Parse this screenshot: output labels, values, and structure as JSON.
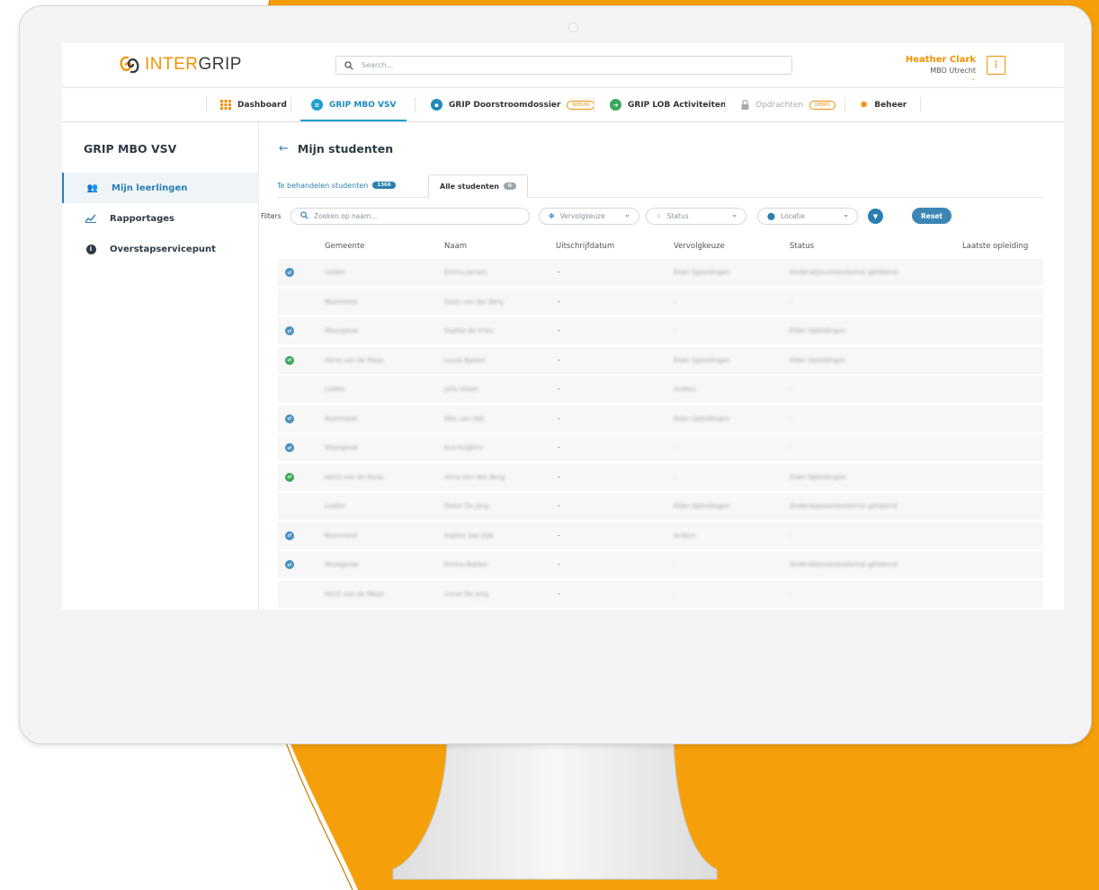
{
  "app": {
    "logo_text_accent": "INTER",
    "logo_text": "GRIP",
    "search_placeholder": "Search...",
    "user_name": "Heather Clark",
    "user_org": "MBO Utrecht",
    "menu_icon": "kebab-icon"
  },
  "tabs": [
    {
      "label": "Dashboard",
      "icon": "grid-icon",
      "state": "normal"
    },
    {
      "label": "GRIP MBO VSV",
      "icon": "filter-icon",
      "state": "active"
    },
    {
      "label": "GRIP Doorstroomdossier",
      "icon": "lock-icon",
      "state": "normal",
      "badge": "NIEUW"
    },
    {
      "label": "GRIP LOB Activiteiten",
      "icon": "run-icon",
      "state": "normal"
    },
    {
      "label": "Opdrachten",
      "icon": "lock-icon",
      "state": "disabled",
      "badge": "DEMO"
    },
    {
      "label": "Beheer",
      "icon": "gear-icon",
      "state": "normal"
    }
  ],
  "sidebar": {
    "title": "GRIP MBO VSV",
    "items": [
      {
        "label": "Mijn leerlingen",
        "icon": "users-icon",
        "active": true
      },
      {
        "label": "Rapportages",
        "icon": "chart-icon",
        "active": false
      },
      {
        "label": "Overstapservicepunt",
        "icon": "info-icon",
        "active": false
      }
    ]
  },
  "main": {
    "title": "Mijn studenten",
    "subtabs": [
      {
        "label": "Te behandelen studenten",
        "count": "1366",
        "selected": false
      },
      {
        "label": "Alle studenten",
        "count": "0",
        "selected": true
      }
    ],
    "filters": {
      "label": "Filters",
      "search_placeholder": "Zoeken op naam...",
      "vervolgkeuze": "Vervolgkeuze",
      "status": "Status",
      "locatie": "Locatie",
      "reset": "Reset"
    },
    "columns": [
      "Gemeente",
      "Naam",
      "Uitschrijfdatum",
      "Vervolgkeuze",
      "Status",
      "Laatste opleiding"
    ],
    "rows": [
      {
        "icon": "blue",
        "gemeente": "Leiden",
        "naam": "Emma Jansen",
        "datum": "-",
        "vervolg": "Elder Opleidingen",
        "status": "Onderwijsovereenkomst getekend"
      },
      {
        "icon": "",
        "gemeente": "Roermond",
        "naam": "Daan van der Berg",
        "datum": "-",
        "vervolg": "-",
        "status": "-"
      },
      {
        "icon": "blue",
        "gemeente": "Maasgouw",
        "naam": "Sophie de Vries",
        "datum": "-",
        "vervolg": "-",
        "status": "Elder Opleidingen"
      },
      {
        "icon": "green",
        "gemeente": "Horst aan de Maas",
        "naam": "Lucas Bakker",
        "datum": "-",
        "vervolg": "Elder Opleidingen",
        "status": "Elder Opleidingen"
      },
      {
        "icon": "",
        "gemeente": "Leiden",
        "naam": "Julia Visser",
        "datum": "-",
        "vervolg": "Anders",
        "status": "-"
      },
      {
        "icon": "blue",
        "gemeente": "Roermond",
        "naam": "Milo van Dijk",
        "datum": "-",
        "vervolg": "Elder Opleidingen",
        "status": "-"
      },
      {
        "icon": "blue",
        "gemeente": "Maasgouw",
        "naam": "Eva Kuijpers",
        "datum": "-",
        "vervolg": "-",
        "status": "-"
      },
      {
        "icon": "green",
        "gemeente": "Horst aan de Maas",
        "naam": "Anna Van den Berg",
        "datum": "-",
        "vervolg": "-",
        "status": "Elder Opleidingen"
      },
      {
        "icon": "",
        "gemeente": "Leiden",
        "naam": "Pieter De Jong",
        "datum": "-",
        "vervolg": "Elder Opleidingen",
        "status": "Onderwijsovereenkomst getekend"
      },
      {
        "icon": "blue",
        "gemeente": "Roermond",
        "naam": "Sophie Van Dijk",
        "datum": "-",
        "vervolg": "Anders",
        "status": "-"
      },
      {
        "icon": "blue",
        "gemeente": "Maasgouw",
        "naam": "Emma Bakker",
        "datum": "-",
        "vervolg": "-",
        "status": "Onderwijsovereenkomst getekend"
      },
      {
        "icon": "",
        "gemeente": "Horst aan de Maas",
        "naam": "Lucas De Jong",
        "datum": "-",
        "vervolg": "-",
        "status": "-"
      }
    ]
  },
  "colors": {
    "brand_orange": "#f29100",
    "background_orange": "#f5a00a",
    "accent_blue": "#2b7fb0",
    "status_blue": "#4a8fc0",
    "status_green": "#3aa85a"
  }
}
